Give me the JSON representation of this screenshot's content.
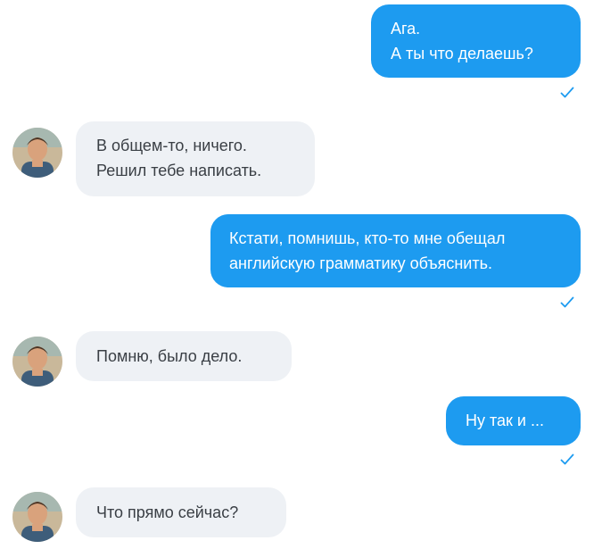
{
  "conversation": {
    "messages": [
      {
        "direction": "out",
        "lines": [
          "Ага.",
          "А ты что делаешь?"
        ],
        "read": true
      },
      {
        "direction": "in",
        "lines": [
          "В общем-то, ничего.",
          "Решил тебе написать."
        ]
      },
      {
        "direction": "out",
        "lines": [
          "Кстати, помнишь, кто-то мне обещал",
          "английскую грамматику объяснить."
        ],
        "read": true
      },
      {
        "direction": "in",
        "lines": [
          "Помню, было дело."
        ]
      },
      {
        "direction": "out",
        "lines": [
          "Ну так и ..."
        ],
        "read": true
      },
      {
        "direction": "in",
        "lines": [
          "Что прямо сейчас?"
        ]
      }
    ]
  },
  "colors": {
    "outgoing_bubble": "#1d9bf0",
    "incoming_bubble": "#eef1f5",
    "read_check": "#1d9bf0"
  },
  "icons": {
    "read_receipt": "checkmark-icon",
    "contact_avatar": "avatar"
  }
}
